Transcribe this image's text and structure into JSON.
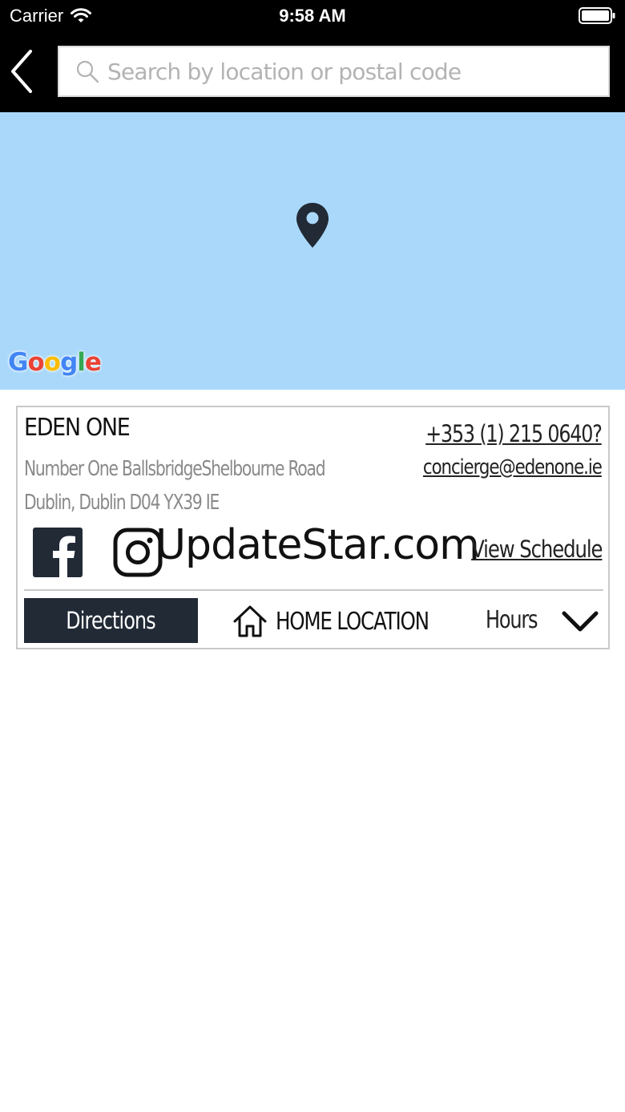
{
  "status_bar": {
    "carrier": "Carrier",
    "time": "9:58 AM"
  },
  "search": {
    "placeholder": "Search by location or postal code",
    "value": ""
  },
  "map": {
    "attribution": "Google",
    "background_color": "#aad8fb",
    "pin_color": "#222a36"
  },
  "location": {
    "name": "EDEN ONE",
    "address_line1": "Number One BallsbridgeShelbourne Road",
    "address_line2": "Dublin, Dublin D04 YX39 IE",
    "phone": "+353 (1) 215 0640?",
    "email": "concierge@edenone.ie",
    "view_schedule_label": "View Schedule",
    "directions_label": "Directions",
    "home_location_label": "HOME LOCATION",
    "hours_label": "Hours"
  },
  "watermark": "UpdateStar.com",
  "icons": [
    "back-icon",
    "search-icon",
    "map-pin-icon",
    "facebook-icon",
    "instagram-icon",
    "home-icon",
    "chevron-down-icon",
    "wifi-icon",
    "battery-icon"
  ],
  "colors": {
    "nav_background": "#000000",
    "button_dark": "#222a36",
    "card_border": "#c9c9c9",
    "address_gray": "#8a8a8a"
  }
}
